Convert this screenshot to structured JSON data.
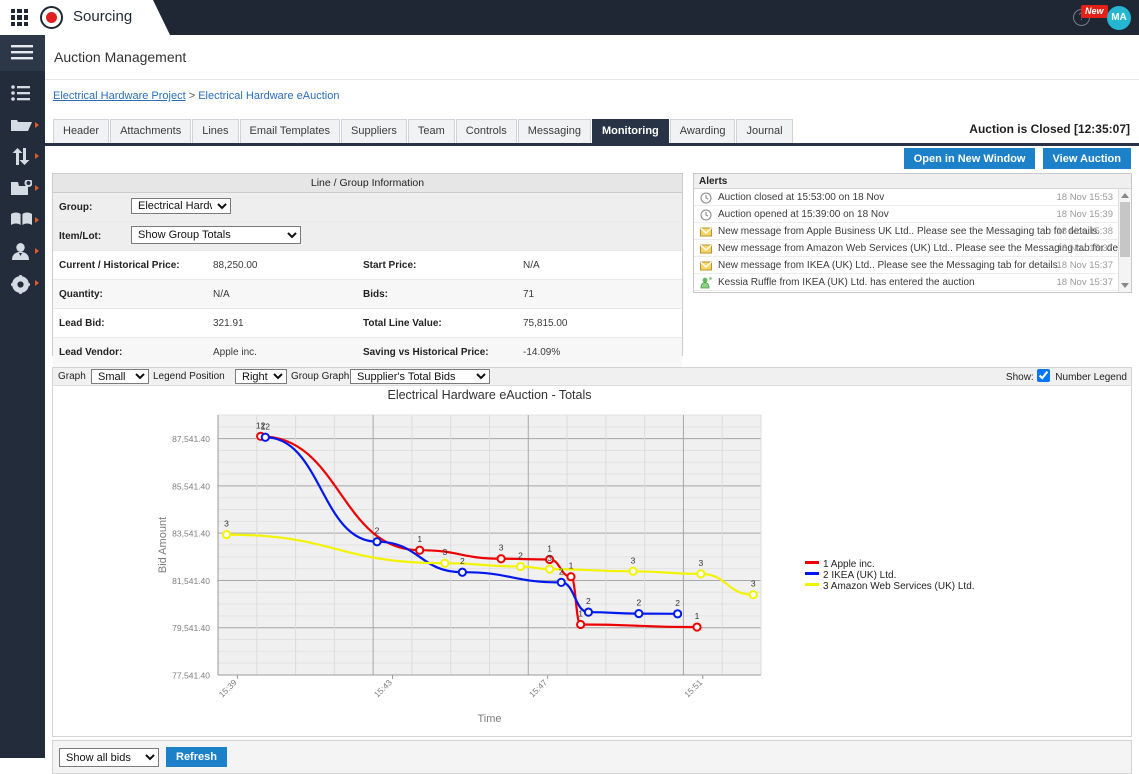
{
  "topbar": {
    "brand": "Sourcing",
    "grid_icon": "app-grid-icon",
    "logo_icon": "record-dot-logo",
    "help_icon": "help-question-icon",
    "new_badge": "New",
    "avatar_initials": "MA"
  },
  "rail": {
    "menu_icon": "hamburger-menu-icon",
    "items": [
      {
        "icon": "list-icon",
        "name": "list"
      },
      {
        "icon": "folder-icon",
        "name": "folder"
      },
      {
        "icon": "transfer-arrows-icon",
        "name": "transfer"
      },
      {
        "icon": "folder-badge-icon",
        "name": "folder-badge"
      },
      {
        "icon": "book-icon",
        "name": "book"
      },
      {
        "icon": "person-icon",
        "name": "person"
      },
      {
        "icon": "gear-icon",
        "name": "settings"
      }
    ]
  },
  "page": {
    "title": "Auction Management",
    "breadcrumb": {
      "project": "Electrical Hardware Project",
      "separator": ">",
      "current": "Electrical Hardware eAuction"
    },
    "auction_status": "Auction is Closed [12:35:07]",
    "tabs": [
      {
        "label": "Header",
        "active": false
      },
      {
        "label": "Attachments",
        "active": false
      },
      {
        "label": "Lines",
        "active": false
      },
      {
        "label": "Email Templates",
        "active": false
      },
      {
        "label": "Suppliers",
        "active": false
      },
      {
        "label": "Team",
        "active": false
      },
      {
        "label": "Controls",
        "active": false
      },
      {
        "label": "Messaging",
        "active": false
      },
      {
        "label": "Monitoring",
        "active": true
      },
      {
        "label": "Awarding",
        "active": false
      },
      {
        "label": "Journal",
        "active": false
      }
    ],
    "buttons": {
      "open_new_window": "Open in New Window",
      "view_auction": "View Auction"
    }
  },
  "line_group": {
    "header": "Line / Group Information",
    "group_label": "Group:",
    "group_value": "Electrical Hardware",
    "item_lot_label": "Item/Lot:",
    "item_lot_value": "Show Group Totals",
    "fields": [
      {
        "label": "Current / Historical Price:",
        "value": "88,250.00",
        "label2": "Start Price:",
        "value2": "N/A"
      },
      {
        "label": "Quantity:",
        "value": "N/A",
        "label2": "Bids:",
        "value2": "71"
      },
      {
        "label": "Lead Bid:",
        "value": "321.91",
        "label2": "Total Line Value:",
        "value2": "75,815.00"
      },
      {
        "label": "Lead Vendor:",
        "value": "Apple inc.",
        "label2": "Saving vs Historical Price:",
        "value2": "-14.09%"
      }
    ]
  },
  "alerts": {
    "header": "Alerts",
    "rows": [
      {
        "icon": "clock-icon",
        "text": "Auction closed at 15:53:00 on 18 Nov",
        "time": "18 Nov 15:53"
      },
      {
        "icon": "clock-icon",
        "text": "Auction opened at 15:39:00 on 18 Nov",
        "time": "18 Nov 15:39"
      },
      {
        "icon": "envelope-icon",
        "text": "New message from Apple Business UK Ltd.. Please see the Messaging tab for details.",
        "time": "18 Nov 15:38"
      },
      {
        "icon": "envelope-icon",
        "text": "New message from Amazon Web Services (UK) Ltd.. Please see the Messaging tab for details.",
        "time": "18 Nov 15:37"
      },
      {
        "icon": "envelope-icon",
        "text": "New message from IKEA (UK) Ltd.. Please see the Messaging tab for details.",
        "time": "18 Nov 15:37"
      },
      {
        "icon": "person-enter-icon",
        "text": "Kessia Ruffle from IKEA (UK) Ltd. has entered the auction",
        "time": "18 Nov 15:37"
      }
    ]
  },
  "chart_toolbar": {
    "graph_label": "Graph",
    "graph_value": "Small",
    "legend_position_label": "Legend Position",
    "legend_position_value": "Right",
    "group_graph_label": "Group Graph",
    "group_graph_value": "Supplier's Total Bids",
    "show_label": "Show:",
    "number_legend_label": "Number Legend",
    "number_legend_checked": true
  },
  "footer": {
    "show_bids_value": "Show all bids",
    "refresh_label": "Refresh"
  },
  "chart_data": {
    "type": "line",
    "title": "Electrical Hardware eAuction - Totals",
    "xlabel": "Time",
    "ylabel": "Bid Amount",
    "ylim": [
      77541.4,
      88541.4
    ],
    "yticks": [
      "87,541.40",
      "85,541.40",
      "83,541.40",
      "81,541.40",
      "79,541.40",
      "77,541.40"
    ],
    "ytick_values": [
      87541.4,
      85541.4,
      83541.4,
      81541.4,
      79541.4,
      77541.4
    ],
    "xticks": [
      "15:39",
      "15:43",
      "15:47",
      "15:51"
    ],
    "xtick_positions": [
      0.5,
      4.5,
      8.5,
      12.5
    ],
    "xlim": [
      0,
      14
    ],
    "grid": true,
    "legend_position": "right",
    "number_legend": true,
    "series": [
      {
        "name": "1 Apple inc.",
        "number": "1",
        "color": "#ee0000",
        "points": [
          {
            "x": 1.1,
            "y": 87640,
            "label": "12"
          },
          {
            "x": 5.2,
            "y": 82820,
            "label": "1"
          },
          {
            "x": 7.3,
            "y": 82460,
            "label": "3"
          },
          {
            "x": 8.55,
            "y": 82430,
            "label": "1"
          },
          {
            "x": 9.1,
            "y": 81700,
            "label": "1"
          },
          {
            "x": 9.35,
            "y": 79680,
            "label": "1"
          },
          {
            "x": 12.35,
            "y": 79570,
            "label": "1"
          }
        ]
      },
      {
        "name": "2 IKEA (UK) Ltd.",
        "number": "2",
        "color": "#0018ee",
        "points": [
          {
            "x": 1.22,
            "y": 87600,
            "label": "12"
          },
          {
            "x": 4.1,
            "y": 83180,
            "label": "2"
          },
          {
            "x": 6.3,
            "y": 81890,
            "label": "2"
          },
          {
            "x": 8.85,
            "y": 81460,
            "label": "2"
          },
          {
            "x": 9.55,
            "y": 80200,
            "label": "2"
          },
          {
            "x": 10.85,
            "y": 80140,
            "label": "2"
          },
          {
            "x": 11.85,
            "y": 80130,
            "label": "2"
          }
        ]
      },
      {
        "name": "3 Amazon Web Services (UK) Ltd.",
        "number": "3",
        "color": "#f3f300",
        "points": [
          {
            "x": 0.22,
            "y": 83480,
            "label": "3"
          },
          {
            "x": 5.85,
            "y": 82270,
            "label": "3"
          },
          {
            "x": 7.8,
            "y": 82130,
            "label": "2"
          },
          {
            "x": 8.55,
            "y": 82020,
            "label": "3"
          },
          {
            "x": 10.7,
            "y": 81930,
            "label": "3"
          },
          {
            "x": 12.45,
            "y": 81820,
            "label": "3"
          },
          {
            "x": 13.8,
            "y": 80940,
            "label": "3"
          }
        ]
      }
    ]
  }
}
